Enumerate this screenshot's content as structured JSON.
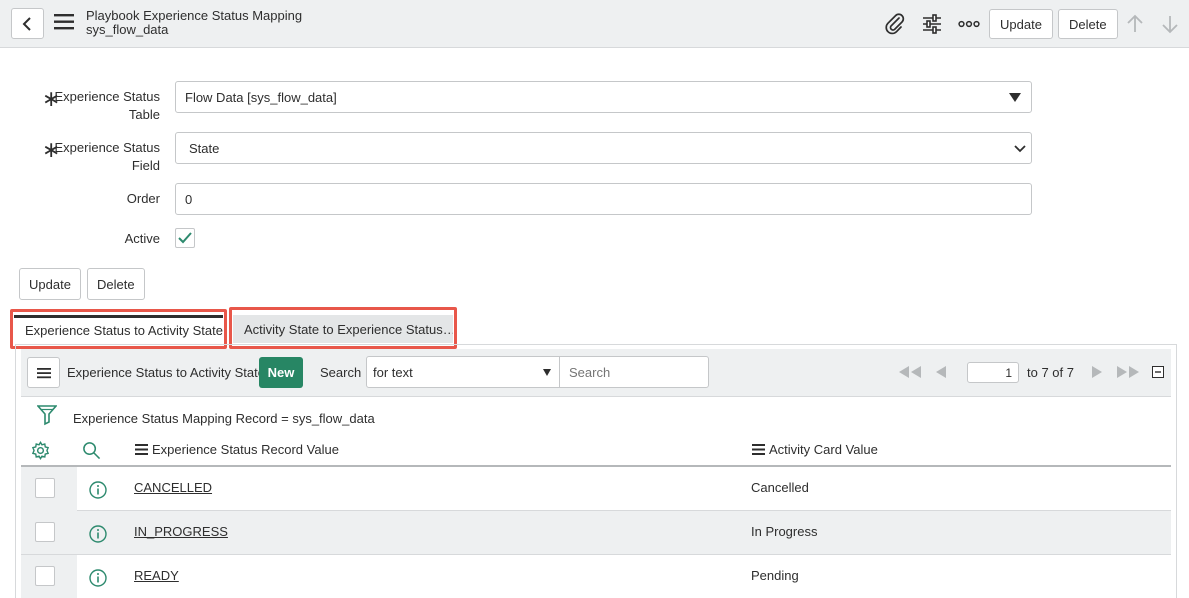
{
  "header": {
    "title": "Playbook Experience Status Mapping",
    "subtitle": "sys_flow_data",
    "update_label": "Update",
    "delete_label": "Delete"
  },
  "form": {
    "fields": [
      {
        "label_line1": "Experience Status",
        "label_line2": "Table",
        "value": "Flow Data [sys_flow_data]",
        "required": true
      },
      {
        "label_line1": "Experience Status",
        "label_line2": "Field",
        "value": "State",
        "required": true
      },
      {
        "label": "Order",
        "value": "0"
      },
      {
        "label": "Active",
        "checked": true
      }
    ],
    "update_label": "Update",
    "delete_label": "Delete"
  },
  "tabs": [
    {
      "label": "Experience Status to Activity State…",
      "active": true
    },
    {
      "label": "Activity State to Experience Status…",
      "active": false
    }
  ],
  "list": {
    "title": "Experience Status to Activity State",
    "new_label": "New",
    "search_label": "Search",
    "search_select": "for text",
    "search_placeholder": "Search",
    "page_value": "1",
    "page_range": "to 7 of 7",
    "filter": "Experience Status Mapping Record = sys_flow_data",
    "columns": [
      "Experience Status Record Value",
      "Activity Card Value"
    ],
    "rows": [
      {
        "record_value": "CANCELLED",
        "card_value": "Cancelled"
      },
      {
        "record_value": "IN_PROGRESS",
        "card_value": "In Progress"
      },
      {
        "record_value": "READY",
        "card_value": "Pending"
      }
    ]
  },
  "colors": {
    "accent": "#278664",
    "highlight": "#e8574a",
    "header_bg": "#eef0f1",
    "icon_teal": "#2d8a6e"
  }
}
